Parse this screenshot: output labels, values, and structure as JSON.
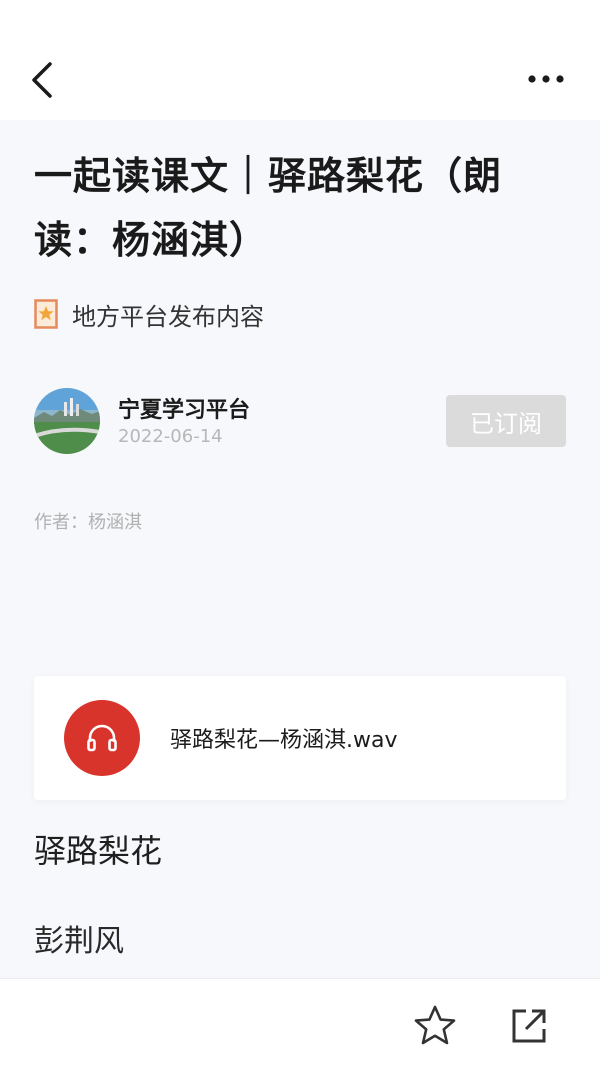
{
  "header": {
    "back_icon": "chevron-left-icon",
    "more_icon": "more-dots-icon"
  },
  "article": {
    "title": "一起读课文｜驿路梨花（朗读：杨涵淇）",
    "platform_label": "地方平台发布内容",
    "platform_icon": "bookmark-star-icon",
    "publisher_name": "宁夏学习平台",
    "publish_date": "2022-06-14",
    "subscribe_label": "已订阅",
    "byline": "作者：杨涵淇"
  },
  "audio": {
    "file_name": "驿路梨花—杨涵淇.wav",
    "icon": "headphones-icon",
    "accent_color": "#d9342b"
  },
  "poem": {
    "title": "驿路梨花",
    "author": "彭荆风"
  },
  "footer": {
    "star_icon": "star-icon",
    "share_icon": "share-external-icon"
  }
}
